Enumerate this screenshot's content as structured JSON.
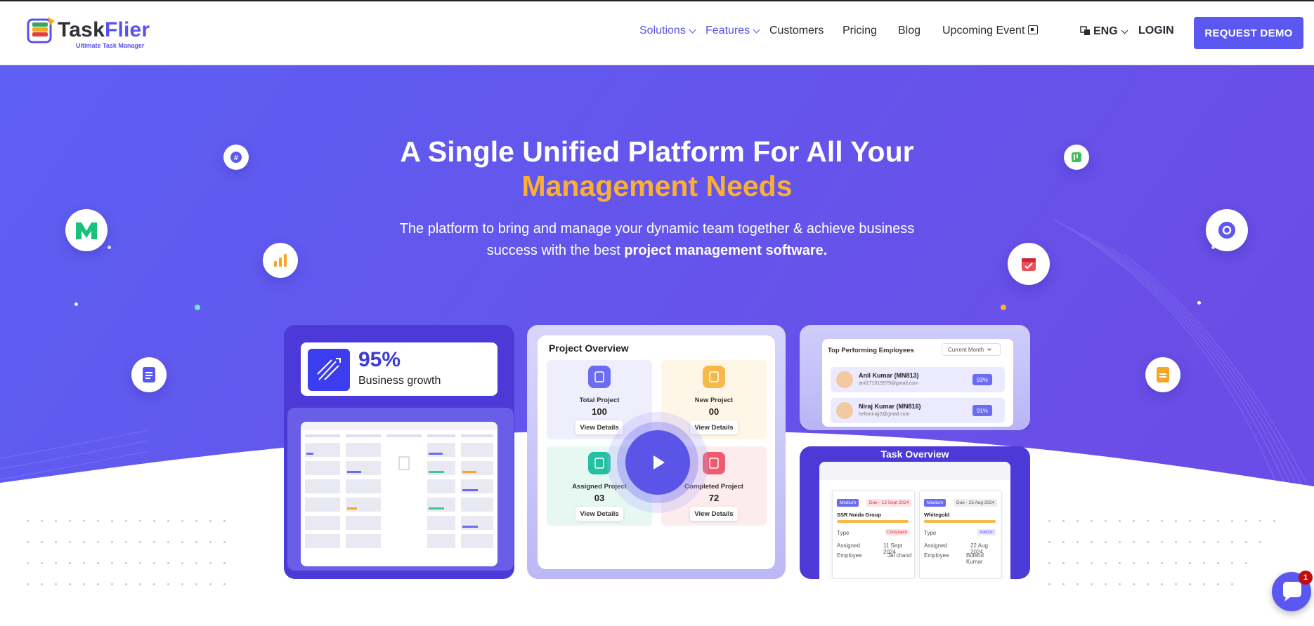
{
  "brand": {
    "name_a": "Task",
    "name_b": "Flier",
    "tagline": "Ultimate Task Manager"
  },
  "nav": {
    "solutions": "Solutions",
    "features": "Features",
    "customers": "Customers",
    "pricing": "Pricing",
    "blog": "Blog",
    "upcoming": "Upcoming Event",
    "language": "ENG",
    "login": "LOGIN",
    "demo": "REQUEST DEMO"
  },
  "hero": {
    "title_line1": "A Single Unified Platform For All Your",
    "title_line2": "Management Needs",
    "subtitle_line1": "The platform to bring and manage your dynamic team together & achieve business",
    "subtitle_line2_plain": "success with the best ",
    "subtitle_line2_bold": "project management software."
  },
  "growth": {
    "value": "95%",
    "label": "Business growth"
  },
  "overview": {
    "title": "Project Overview",
    "view_label": "View Details",
    "cells": [
      {
        "title": "Total Project",
        "value": "100"
      },
      {
        "title": "New Project",
        "value": "00"
      },
      {
        "title": "Assigned Project",
        "value": "03"
      },
      {
        "title": "Completed Project",
        "value": "72"
      }
    ]
  },
  "top_employees": {
    "title": "Top Performing Employees",
    "filter": "Current Month",
    "rows": [
      {
        "name": "Anil Kumar (MN813)",
        "email": "anil171019979@gmail.com",
        "score": "93%"
      },
      {
        "name": "Niraj Kumar (MN816)",
        "email": "hellonirajj2@gmail.com",
        "score": "91%"
      }
    ]
  },
  "task_overview": {
    "title": "Task Overview",
    "cards": [
      {
        "priority": "Medium",
        "due": "Due - 12 Sept 2024",
        "project": "SSR Noida Group",
        "type_label": "Type",
        "type": "Complaint",
        "assigned_label": "Assigned",
        "assigned": "11 Sept 2024",
        "employee_label": "Employee",
        "employee": "Jai chand"
      },
      {
        "priority": "Medium",
        "due": "Due - 25 Aug 2024",
        "project": "Whitegold",
        "type_label": "Type",
        "type": "AddOn",
        "assigned_label": "Assigned",
        "assigned": "22 Aug 2024",
        "employee_label": "Employee",
        "employee": "Bulend Kumar"
      }
    ]
  },
  "chat": {
    "badge": "1"
  },
  "colors": {
    "brand": "#5b57f1",
    "accent": "#fbb034",
    "hero_start": "#5f5ef2",
    "hero_end": "#6c4ee6"
  }
}
